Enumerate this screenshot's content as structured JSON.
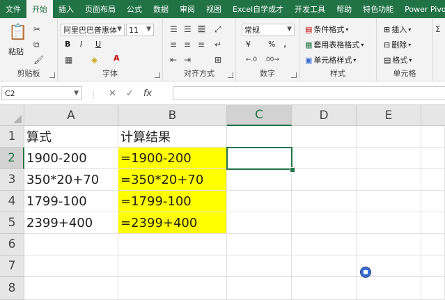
{
  "tabs": [
    "文件",
    "开始",
    "插入",
    "页面布局",
    "公式",
    "数据",
    "审阅",
    "视图",
    "Excel自学成才",
    "开发工具",
    "帮助",
    "特色功能",
    "Power Pivot"
  ],
  "active_tab": "开始",
  "ribbon": {
    "clipboard": {
      "label": "剪贴板",
      "paste": "粘贴"
    },
    "font": {
      "label": "字体",
      "font_name": "阿里巴巴普惠体",
      "font_size": "11",
      "bold": "B",
      "italic": "I",
      "underline": "U",
      "font_color_letter": "A"
    },
    "alignment": {
      "label": "对齐方式"
    },
    "number": {
      "label": "数字",
      "format": "常规",
      "percent": "%",
      "comma": ",",
      "currency": "¥"
    },
    "styles": {
      "label": "样式",
      "conditional": "条件格式",
      "table": "套用表格格式",
      "cell_styles": "单元格样式"
    },
    "cells": {
      "label": "单元格",
      "insert": "插入",
      "delete": "删除",
      "format": "格式"
    }
  },
  "formula_bar": {
    "name_box": "C2",
    "cancel": "✕",
    "confirm": "✓",
    "fx": "fx",
    "value": ""
  },
  "columns": [
    "A",
    "B",
    "C",
    "D",
    "E"
  ],
  "rows": [
    "1",
    "2",
    "3",
    "4",
    "5",
    "6",
    "7",
    "8"
  ],
  "cells": {
    "A1": "算式",
    "B1": "计算结果",
    "A2": "1900-200",
    "B2": "=1900-200",
    "A3": "350*20+70",
    "B3": "=350*20+70",
    "A4": "1799-100",
    "B4": "=1799-100",
    "A5": "2399+400",
    "B5": "=2399+400"
  },
  "colors": {
    "accent": "#217346",
    "highlight": "#ffff00"
  }
}
